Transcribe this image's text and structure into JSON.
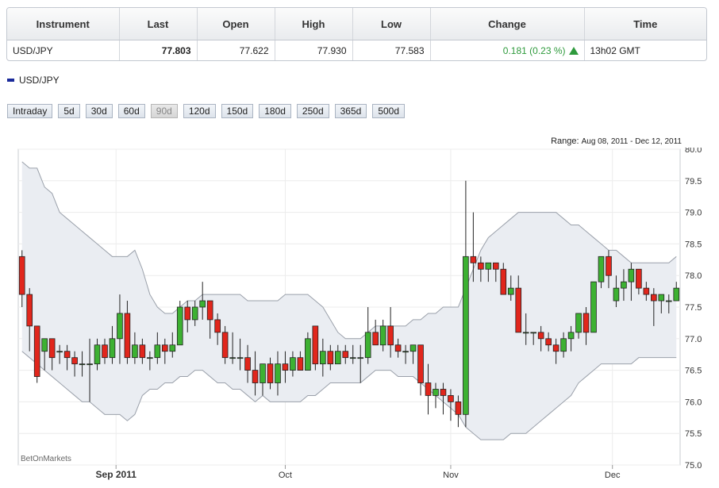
{
  "table": {
    "headers": [
      "Instrument",
      "Last",
      "Open",
      "High",
      "Low",
      "Change",
      "Time"
    ],
    "row": {
      "instrument": "USD/JPY",
      "last": "77.803",
      "open": "77.622",
      "high": "77.930",
      "low": "77.583",
      "change": "0.181 (0.23 %)",
      "time": "13h02 GMT"
    }
  },
  "legend_label": "USD/JPY",
  "range_buttons": [
    "Intraday",
    "5d",
    "30d",
    "60d",
    "90d",
    "120d",
    "150d",
    "180d",
    "250d",
    "365d",
    "500d"
  ],
  "active_range": "90d",
  "range_text": {
    "label": "Range:",
    "dates": "Aug 08, 2011 - Dec 12, 2011"
  },
  "watermark": "BetOnMarkets",
  "colors": {
    "up": "#3db132",
    "down": "#e1261c",
    "band": "#eaedf2",
    "change": "#2e9a3c",
    "legend": "#1a2a9a"
  },
  "chart_data": {
    "type": "candlestick",
    "ylim": [
      75.0,
      80.0
    ],
    "y_ticks": [
      "80.0",
      "79.5",
      "79.0",
      "78.5",
      "78.0",
      "77.5",
      "77.0",
      "76.5",
      "76.0",
      "75.5",
      "75.0"
    ],
    "x_ticks": [
      "Sep 2011",
      "Oct",
      "Nov",
      "Dec"
    ],
    "x_tick_index": [
      12.5,
      35,
      57,
      78.5
    ],
    "grid": true,
    "series": [
      {
        "name": "USD/JPY",
        "candles": [
          [
            78.3,
            78.4,
            77.5,
            77.7
          ],
          [
            77.7,
            77.8,
            76.8,
            77.2
          ],
          [
            77.2,
            77.2,
            76.3,
            76.4
          ],
          [
            76.8,
            77.0,
            76.5,
            77.0
          ],
          [
            77.0,
            77.0,
            76.5,
            76.7
          ],
          [
            76.8,
            76.9,
            76.6,
            76.8
          ],
          [
            76.8,
            76.9,
            76.5,
            76.7
          ],
          [
            76.7,
            76.8,
            76.4,
            76.6
          ],
          [
            76.6,
            76.8,
            76.4,
            76.6
          ],
          [
            76.6,
            77.0,
            76.0,
            76.6
          ],
          [
            76.6,
            77.0,
            76.5,
            76.9
          ],
          [
            76.9,
            77.0,
            76.6,
            76.7
          ],
          [
            76.7,
            77.2,
            76.6,
            77.0
          ],
          [
            77.0,
            77.7,
            76.6,
            77.4
          ],
          [
            77.4,
            77.6,
            76.6,
            76.7
          ],
          [
            76.7,
            77.1,
            76.6,
            76.9
          ],
          [
            76.9,
            77.0,
            76.6,
            76.7
          ],
          [
            76.7,
            76.8,
            76.5,
            76.7
          ],
          [
            76.7,
            77.1,
            76.6,
            76.9
          ],
          [
            76.9,
            77.0,
            76.6,
            76.8
          ],
          [
            76.8,
            77.1,
            76.7,
            76.9
          ],
          [
            76.9,
            77.6,
            76.9,
            77.5
          ],
          [
            77.5,
            77.6,
            77.1,
            77.3
          ],
          [
            77.3,
            77.6,
            77.2,
            77.5
          ],
          [
            77.5,
            77.9,
            77.3,
            77.6
          ],
          [
            77.6,
            77.6,
            77.0,
            77.3
          ],
          [
            77.3,
            77.4,
            76.9,
            77.1
          ],
          [
            77.1,
            77.2,
            76.6,
            76.7
          ],
          [
            76.7,
            77.1,
            76.6,
            76.7
          ],
          [
            76.7,
            77.0,
            76.5,
            76.7
          ],
          [
            76.7,
            76.9,
            76.3,
            76.5
          ],
          [
            76.5,
            76.8,
            76.1,
            76.3
          ],
          [
            76.3,
            76.6,
            76.1,
            76.6
          ],
          [
            76.6,
            76.7,
            76.2,
            76.3
          ],
          [
            76.3,
            76.8,
            76.1,
            76.6
          ],
          [
            76.6,
            76.8,
            76.3,
            76.5
          ],
          [
            76.5,
            76.8,
            76.4,
            76.7
          ],
          [
            76.7,
            76.8,
            76.5,
            76.5
          ],
          [
            76.5,
            77.1,
            76.5,
            77.0
          ],
          [
            77.2,
            77.2,
            76.5,
            76.6
          ],
          [
            76.6,
            77.0,
            76.4,
            76.8
          ],
          [
            76.8,
            76.9,
            76.5,
            76.6
          ],
          [
            76.6,
            76.9,
            76.6,
            76.8
          ],
          [
            76.8,
            76.9,
            76.6,
            76.7
          ],
          [
            76.7,
            76.9,
            76.6,
            76.7
          ],
          [
            76.7,
            76.9,
            76.3,
            76.7
          ],
          [
            76.7,
            77.5,
            76.6,
            77.1
          ],
          [
            77.1,
            77.3,
            76.9,
            76.9
          ],
          [
            76.9,
            77.3,
            76.8,
            77.2
          ],
          [
            77.2,
            77.5,
            76.7,
            76.9
          ],
          [
            76.9,
            77.0,
            76.7,
            76.8
          ],
          [
            76.8,
            76.9,
            76.6,
            76.8
          ],
          [
            76.8,
            76.9,
            76.6,
            76.9
          ],
          [
            76.9,
            76.9,
            76.1,
            76.3
          ],
          [
            76.3,
            76.6,
            75.8,
            76.1
          ],
          [
            76.1,
            76.3,
            75.9,
            76.2
          ],
          [
            76.2,
            76.3,
            75.8,
            76.1
          ],
          [
            76.1,
            76.2,
            75.7,
            76.0
          ],
          [
            76.0,
            76.1,
            75.6,
            75.8
          ],
          [
            75.8,
            79.5,
            75.6,
            78.3
          ],
          [
            78.3,
            79.0,
            77.9,
            78.2
          ],
          [
            78.2,
            78.3,
            77.9,
            78.1
          ],
          [
            78.1,
            78.2,
            77.9,
            78.2
          ],
          [
            78.2,
            78.2,
            77.9,
            78.1
          ],
          [
            78.1,
            78.2,
            77.7,
            77.7
          ],
          [
            77.7,
            78.0,
            77.6,
            77.8
          ],
          [
            77.8,
            78.0,
            77.2,
            77.1
          ],
          [
            77.1,
            77.4,
            76.9,
            77.1
          ],
          [
            77.1,
            77.1,
            76.9,
            77.1
          ],
          [
            77.1,
            77.2,
            76.8,
            77.0
          ],
          [
            77.0,
            77.1,
            76.8,
            76.9
          ],
          [
            76.9,
            77.0,
            76.6,
            76.8
          ],
          [
            76.8,
            77.1,
            76.7,
            77.0
          ],
          [
            77.0,
            77.2,
            76.8,
            77.1
          ],
          [
            77.1,
            77.4,
            77.0,
            77.4
          ],
          [
            77.4,
            77.5,
            76.9,
            77.1
          ],
          [
            77.1,
            77.9,
            77.1,
            77.9
          ],
          [
            77.9,
            78.3,
            77.8,
            78.3
          ],
          [
            78.3,
            78.4,
            77.8,
            78.0
          ],
          [
            77.6,
            78.0,
            77.5,
            77.8
          ],
          [
            77.8,
            78.1,
            77.6,
            77.9
          ],
          [
            77.9,
            78.2,
            77.6,
            78.1
          ],
          [
            78.1,
            78.1,
            77.7,
            77.8
          ],
          [
            77.8,
            77.9,
            77.6,
            77.7
          ],
          [
            77.7,
            77.8,
            77.2,
            77.6
          ],
          [
            77.6,
            77.7,
            77.4,
            77.7
          ],
          [
            77.6,
            77.7,
            77.4,
            77.6
          ],
          [
            77.6,
            77.9,
            77.6,
            77.8
          ]
        ],
        "bollinger_upper": [
          79.8,
          79.7,
          79.7,
          79.4,
          79.3,
          79.0,
          78.9,
          78.8,
          78.7,
          78.6,
          78.5,
          78.4,
          78.3,
          78.3,
          78.3,
          78.4,
          78.1,
          77.7,
          77.5,
          77.4,
          77.4,
          77.5,
          77.6,
          77.6,
          77.7,
          77.7,
          77.7,
          77.7,
          77.7,
          77.7,
          77.6,
          77.6,
          77.6,
          77.6,
          77.6,
          77.7,
          77.7,
          77.7,
          77.7,
          77.6,
          77.5,
          77.3,
          77.1,
          77.0,
          77.0,
          77.0,
          77.1,
          77.2,
          77.2,
          77.2,
          77.2,
          77.2,
          77.3,
          77.3,
          77.4,
          77.4,
          77.5,
          77.5,
          77.5,
          77.8,
          78.1,
          78.4,
          78.6,
          78.7,
          78.8,
          78.9,
          79.0,
          79.0,
          79.0,
          79.0,
          79.0,
          79.0,
          78.9,
          78.8,
          78.8,
          78.7,
          78.6,
          78.5,
          78.4,
          78.4,
          78.3,
          78.2,
          78.2,
          78.2,
          78.2,
          78.2,
          78.2,
          78.3
        ]
      },
      {
        "name": "bollinger_lower",
        "values": [
          76.8,
          76.7,
          76.6,
          76.5,
          76.4,
          76.3,
          76.2,
          76.1,
          76.0,
          76.0,
          75.9,
          75.8,
          75.8,
          75.8,
          75.7,
          75.8,
          76.1,
          76.2,
          76.2,
          76.3,
          76.3,
          76.4,
          76.4,
          76.5,
          76.5,
          76.4,
          76.3,
          76.3,
          76.2,
          76.2,
          76.1,
          76.0,
          76.1,
          76.0,
          76.0,
          76.0,
          76.0,
          76.0,
          76.1,
          76.1,
          76.2,
          76.3,
          76.3,
          76.3,
          76.3,
          76.3,
          76.4,
          76.5,
          76.5,
          76.5,
          76.4,
          76.4,
          76.4,
          76.3,
          76.2,
          76.1,
          76.0,
          75.9,
          75.8,
          75.6,
          75.5,
          75.4,
          75.4,
          75.4,
          75.4,
          75.5,
          75.5,
          75.5,
          75.6,
          75.7,
          75.8,
          75.9,
          76.0,
          76.1,
          76.3,
          76.4,
          76.5,
          76.6,
          76.6,
          76.6,
          76.6,
          76.6,
          76.7,
          76.7,
          76.7,
          76.7,
          76.7,
          76.7
        ]
      }
    ]
  }
}
